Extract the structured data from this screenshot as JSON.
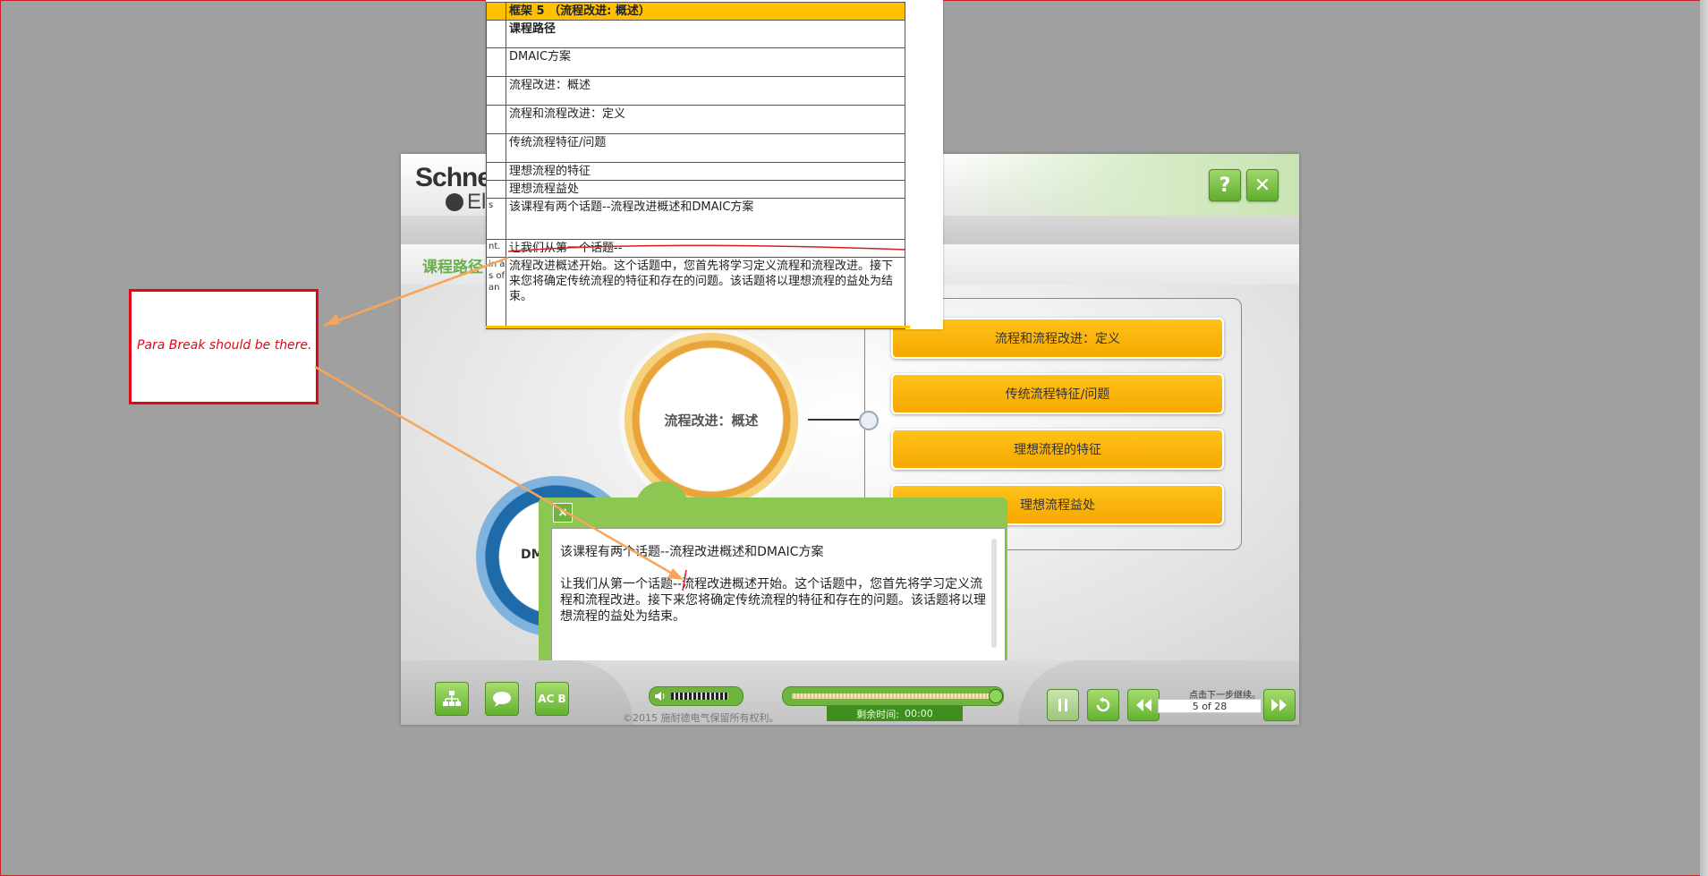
{
  "player": {
    "logo_line1": "Schne",
    "logo_line2": "El",
    "help_label": "?",
    "close_label": "✕",
    "course_title": "课程路径",
    "center_topic": "流程改进：概述",
    "left_topic": "DM",
    "topics": [
      "流程和流程改进：定义",
      "传统流程特征/问题",
      "理想流程的特征",
      "理想流程益处"
    ],
    "popup": {
      "close_label": "×",
      "paragraph1": "该课程有两个话题--流程改进概述和DMAIC方案",
      "paragraph2": "让我们从第一个话题--流程改进概述开始。这个话题中，您首先将学习定义流程和流程改进。接下来您将确定传统流程的特征和存在的问题。该话题将以理想流程的益处为结束。"
    },
    "bottom": {
      "menu_icon": "menu-icon",
      "transcript_icon": "speech-bubble-icon",
      "glossary_label": "AC B",
      "copyright": "©2015 施耐德电气保留所有权利。",
      "time_label": "剩余时间:",
      "time_value": "00:00",
      "next_hint": "点击下一步继续。",
      "page_indicator": "5 of 28",
      "progress": 1.0
    },
    "colors": {
      "accent_green": "#6fb43f",
      "topic_orange": "#ffc000",
      "title_green": "#6ab04c"
    }
  },
  "doc": {
    "header": "框架 5 （流程改进: 概述）",
    "rows": [
      {
        "left": "",
        "text": "课程路径",
        "bold": true
      },
      {
        "left": "",
        "text": "DMAIC方案"
      },
      {
        "left": "",
        "text": "流程改进：概述"
      },
      {
        "left": "",
        "text": "流程和流程改进：定义"
      },
      {
        "left": "",
        "text": "传统流程特征/问题"
      },
      {
        "left": "",
        "text": "理想流程的特征"
      },
      {
        "left": "",
        "text": "理想流程益处"
      },
      {
        "left": "s",
        "text": "该课程有两个话题--流程改进概述和DMAIC方案"
      },
      {
        "left": "nt.",
        "text": "让我们从第一个话题--"
      },
      {
        "left": "in a",
        "text": "流程改进概述开始。这个话题中，您首先将学习定义流程和流程改进。接下来您将确定传统流程的特征和存在的问题。该话题将以理想流程的益处为结束。"
      }
    ],
    "left_fragments": [
      "s of",
      "an"
    ]
  },
  "annotation": {
    "text": "Para Break should be there."
  }
}
